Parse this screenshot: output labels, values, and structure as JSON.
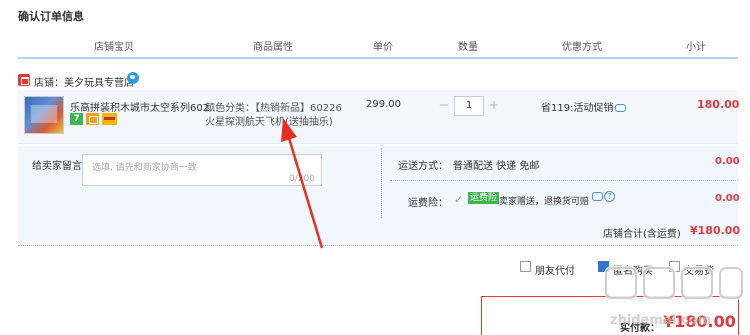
{
  "page": {
    "title": "确认订单信息"
  },
  "table_header": {
    "col_item": "店铺宝贝",
    "col_attr": "商品属性",
    "col_price": "单价",
    "col_qty": "数量",
    "col_promo": "优惠方式",
    "col_subtotal": "小计"
  },
  "shop": {
    "label": "店铺：美夕玩具专营店"
  },
  "item": {
    "title": "乐高拼装积木城市太空系列602...",
    "attr_line1": "颜色分类：【热销新品】60226",
    "attr_line2": "火星探测航天飞机(送抽抽乐)",
    "price": "299.00",
    "qty_minus": "−",
    "qty_value": "1",
    "qty_plus": "+",
    "promo": "省119:活动促销",
    "subtotal": "180.00",
    "svc_icon_1": "7"
  },
  "message": {
    "label": "给卖家留言：",
    "placeholder": "选填, 请先和商家协商一致",
    "count": "0/200"
  },
  "shipping": {
    "label": "运送方式：",
    "value": "普通配送 快递 免邮",
    "fee": "0.00"
  },
  "insurance": {
    "label": "运费险：",
    "check": "✓",
    "badge": "运费险",
    "desc": "卖家赠送，退换货可赔",
    "help": "?",
    "fee": "0.00"
  },
  "shop_total": {
    "label": "店铺合计(含运费)",
    "value": "¥180.00"
  },
  "options": {
    "friend_pay": "朋友代付",
    "anonymous": "匿名购买",
    "fee_note": "交易费"
  },
  "payment": {
    "label": "实付款：",
    "value": "¥180.00"
  },
  "watermark": {
    "text": "值 什么值得买"
  },
  "colors": {
    "price_red": "#e4393c",
    "header_line": "#b2d1ff",
    "panel_bg": "#f2f7ff",
    "annotation_arrow": "#e8301e"
  }
}
